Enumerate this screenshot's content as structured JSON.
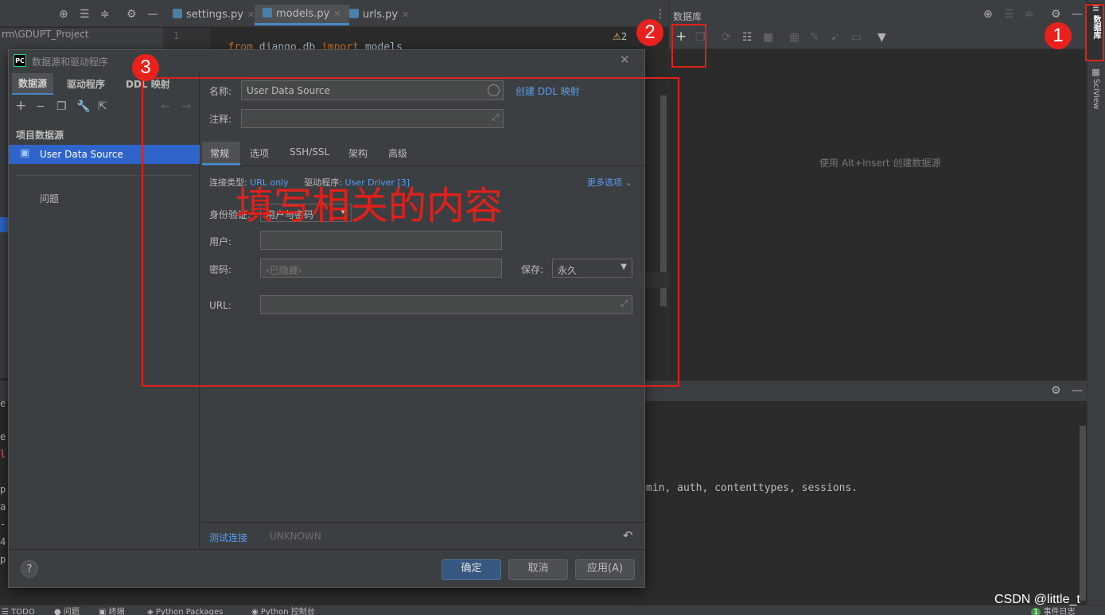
{
  "project": {
    "path": "rm\\GDUPT_Project"
  },
  "editor": {
    "tabs": [
      {
        "label": "settings.py"
      },
      {
        "label": "models.py"
      },
      {
        "label": "urls.py"
      }
    ],
    "line_number": "1",
    "code": {
      "kw1": "from",
      "mod": " django.db ",
      "kw2": "import",
      "name": " models"
    },
    "warning": "2"
  },
  "db_panel": {
    "title": "数据库",
    "hint": "使用 Alt+Insert 创建数据源"
  },
  "right_strip": {
    "db_label": "数据库",
    "sciview_label": "SciView"
  },
  "terminal": {
    "line": "min, auth, contenttypes, sessions.",
    "left_chars": [
      "e",
      "e",
      "l",
      "p",
      "a",
      "-",
      "4",
      "p"
    ]
  },
  "dialog": {
    "title": "数据源和驱动程序",
    "tabs": [
      {
        "label": "数据源"
      },
      {
        "label": "驱动程序"
      },
      {
        "label": "DDL 映射"
      }
    ],
    "sidebar": {
      "section": "项目数据源",
      "item": "User Data Source",
      "problems": "问题"
    },
    "name_label": "名称:",
    "name_value": "User Data Source",
    "ddl_link": "创建 DDL 映射",
    "comment_label": "注释:",
    "subtabs": [
      {
        "label": "常规"
      },
      {
        "label": "选项"
      },
      {
        "label": "SSH/SSL"
      },
      {
        "label": "架构"
      },
      {
        "label": "高级"
      }
    ],
    "conn_type_label": "连接类型:",
    "conn_type_value": "URL only",
    "driver_label": "驱动程序:",
    "driver_value": "User Driver [3]",
    "more_options": "更多选项",
    "auth_label": "身份验证:",
    "auth_value": "用户与密码",
    "user_label": "用户:",
    "password_label": "密码:",
    "password_placeholder": "‹已隐藏›",
    "save_label": "保存:",
    "save_value": "永久",
    "url_label": "URL:",
    "test_connection": "测试连接",
    "status": "UNKNOWN",
    "ok": "确定",
    "cancel": "取消",
    "apply": "应用(A)",
    "help": "?"
  },
  "annotations": {
    "fill_text": "填写相关的内容",
    "n1": "1",
    "n2": "2",
    "n3": "3"
  },
  "statusbar": {
    "items": [
      {
        "label": "TODO"
      },
      {
        "label": "问题"
      },
      {
        "label": "终端"
      },
      {
        "label": "Python Packages"
      },
      {
        "label": "Python 控制台"
      }
    ],
    "event_log": "事件日志",
    "event_count": "1"
  },
  "watermark": "CSDN @little_t",
  "colors": {
    "accent": "#589df6",
    "annotation_red": "#e0201b",
    "selection": "#2f65ca"
  }
}
